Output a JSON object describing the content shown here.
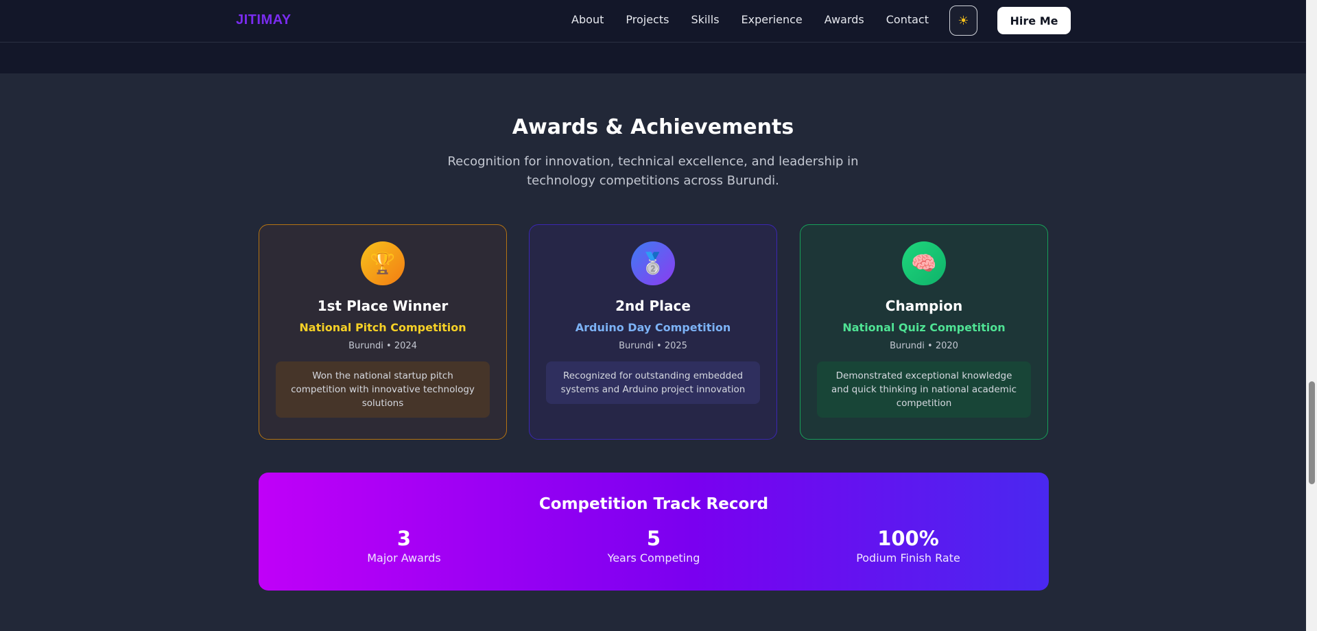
{
  "nav": {
    "logo": "JITIMAY",
    "links": [
      "About",
      "Projects",
      "Skills",
      "Experience",
      "Awards",
      "Contact"
    ],
    "theme_icon": "sun-icon",
    "hire_label": "Hire Me"
  },
  "awards": {
    "title": "Awards & Achievements",
    "subtitle": "Recognition for innovation, technical excellence, and leadership in technology competitions across Burundi.",
    "cards": [
      {
        "icon": "trophy-icon",
        "title": "1st Place Winner",
        "competition": "National Pitch Competition",
        "meta": "Burundi • 2024",
        "description": "Won the national startup pitch competition with innovative technology solutions",
        "accent": "#f6d126"
      },
      {
        "icon": "medal-icon",
        "title": "2nd Place",
        "competition": "Arduino Day Competition",
        "meta": "Burundi • 2025",
        "description": "Recognized for outstanding embedded systems and Arduino project innovation",
        "accent": "#7cb2f5"
      },
      {
        "icon": "brain-icon",
        "title": "Champion",
        "competition": "National Quiz Competition",
        "meta": "Burundi • 2020",
        "description": "Demonstrated exceptional knowledge and quick thinking in national academic competition",
        "accent": "#4fe394"
      }
    ]
  },
  "track": {
    "title": "Competition Track Record",
    "stats": [
      {
        "value": "3",
        "label": "Major Awards"
      },
      {
        "value": "5",
        "label": "Years Competing"
      },
      {
        "value": "100%",
        "label": "Podium Finish Rate"
      }
    ]
  }
}
